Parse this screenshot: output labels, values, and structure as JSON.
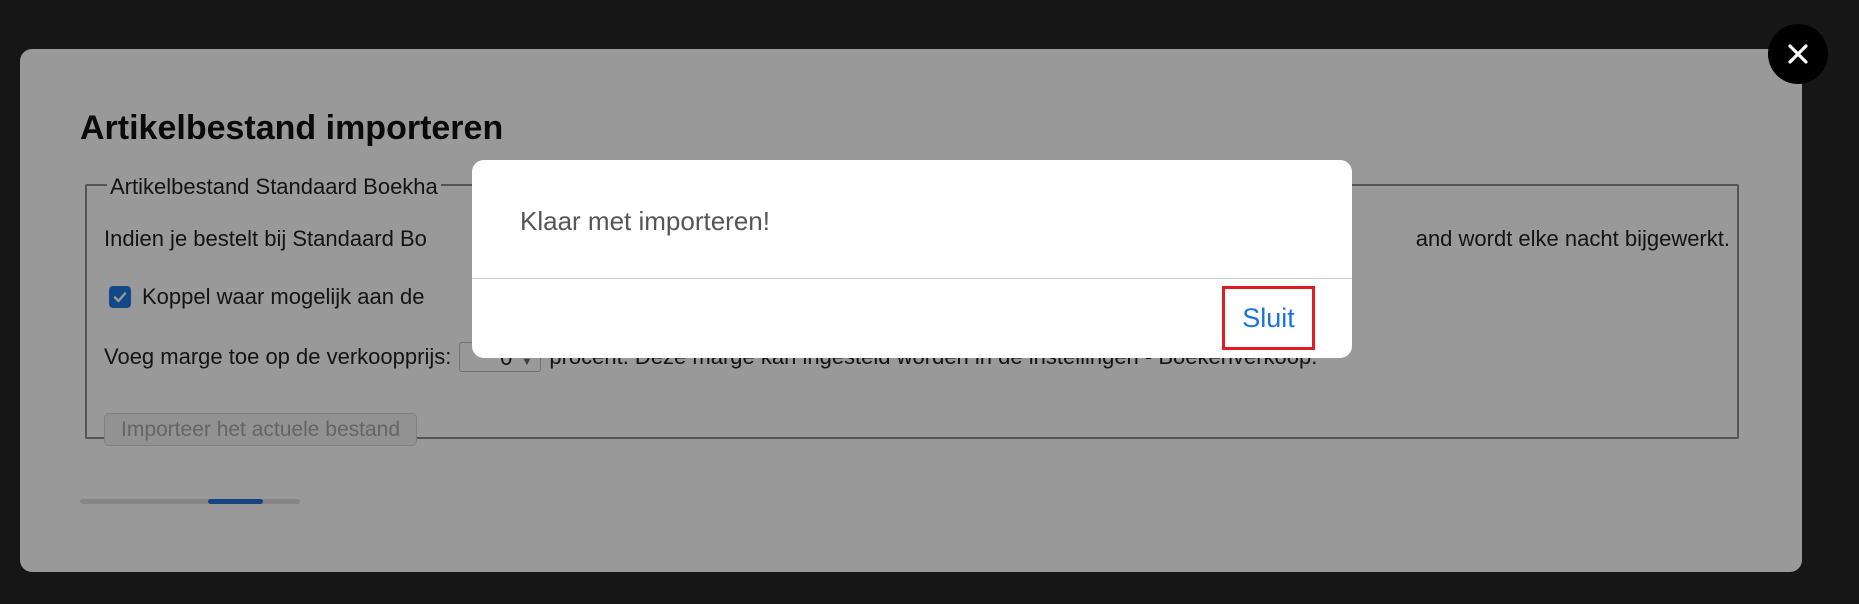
{
  "page": {
    "title": "Artikelbestand importeren"
  },
  "fieldset": {
    "legend": "Artikelbestand Standaard Boekha",
    "description_left": "Indien je bestelt bij Standaard Bo",
    "description_right": "and wordt elke nacht bijgewerkt.",
    "checkbox_label": "Koppel waar mogelijk aan de",
    "checkbox_checked": true,
    "margin_label": "Voeg marge toe op de verkoopprijs:",
    "margin_value": "0",
    "margin_suffix": "procent. Deze marge kan ingesteld worden in de instellingen - Boekenverkoop.",
    "import_button_label": "Importeer het actuele bestand"
  },
  "progress": {
    "value_fraction": 0.25
  },
  "alert": {
    "message": "Klaar met importeren!",
    "close_label": "Sluit"
  },
  "icons": {
    "close": "close-icon",
    "checkbox": "checkmark-icon"
  },
  "colors": {
    "accent": "#1a73d9",
    "checkbox": "#1f78e0",
    "highlight": "#e21b23",
    "progress": "#2a6fdb",
    "backdrop": "#262626"
  }
}
